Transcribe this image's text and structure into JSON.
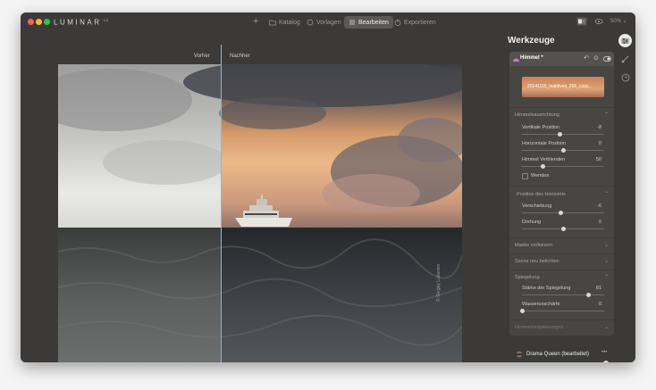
{
  "app": {
    "logo": "LUMINAR",
    "version": "4.3"
  },
  "nav": {
    "tabs": [
      {
        "label": "Katalog",
        "icon": "folder-icon"
      },
      {
        "label": "Vorlagen",
        "icon": "presets-icon"
      },
      {
        "label": "Bearbeiten",
        "icon": "sliders-icon"
      },
      {
        "label": "Exportieren",
        "icon": "export-icon"
      }
    ],
    "zoom": "50%"
  },
  "canvas": {
    "before_label": "Vorher",
    "after_label": "Nachher",
    "watermark": "© Sergey Lukankin"
  },
  "panel": {
    "title": "Werkzeuge",
    "tool": {
      "name": "Himmel",
      "modified": "*",
      "sky_file": "20141115_maldives_265_copy..."
    },
    "sections": {
      "sky_alignment": "Himmelsausrichtung",
      "horizon_position": "Position des Horizonts",
      "mask_refine": "Maske verfeinern",
      "relight_scene": "Szene neu belichten",
      "reflection": "Spiegelung",
      "advanced": "Himmelsanpassungen"
    },
    "sliders": [
      {
        "label": "Vertikale Position",
        "value": "-8",
        "fraction": 0.46
      },
      {
        "label": "Horizontale Position",
        "value": "0",
        "fraction": 0.5
      },
      {
        "label": "Himmel Verblenden",
        "value": "50",
        "fraction": 0.25
      },
      {
        "label": "Verschiebung",
        "value": "-6",
        "fraction": 0.47
      },
      {
        "label": "Drehung",
        "value": "0",
        "fraction": 0.5
      },
      {
        "label": "Stärke der Spiegelung",
        "value": "81",
        "fraction": 0.81
      },
      {
        "label": "Wasserunschärfe",
        "value": "0",
        "fraction": 0.0
      }
    ],
    "flip_label": "Wenden",
    "preset": {
      "name": "Drama Queen (bearbeitet)",
      "menu": "•••",
      "amount": 1.0
    }
  },
  "colors": {
    "accent": "#d56bd6",
    "divider": "#8fb6d8",
    "bg": "#3b3a39"
  }
}
